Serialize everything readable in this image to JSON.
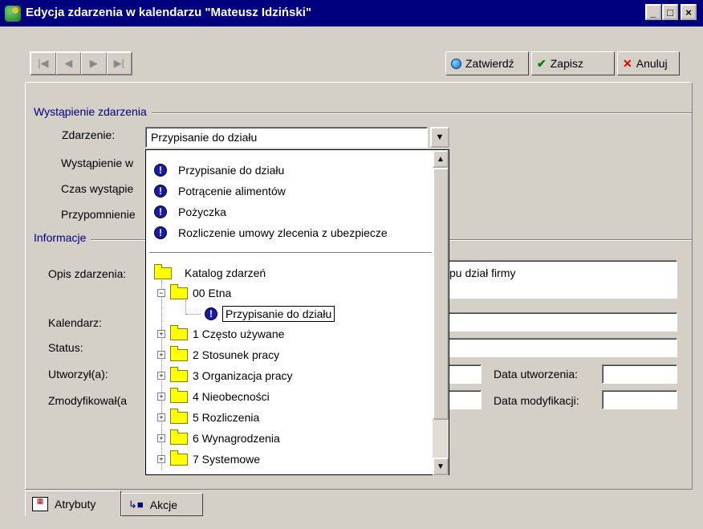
{
  "window": {
    "title": "Edycja zdarzenia w kalendarzu \"Mateusz Idziński\"",
    "controls": [
      "_",
      "□",
      "×"
    ]
  },
  "toolbar": {
    "nav": [
      "|◀",
      "◀",
      "▶",
      "▶|"
    ],
    "confirm_label": "Zatwierdź",
    "save_label": "Zapisz",
    "cancel_label": "Anuluj"
  },
  "occurrence": {
    "section_title": "Wystąpienie zdarzenia",
    "event_label": "Zdarzenie:",
    "event_value": "Przypisanie do działu",
    "occurrence_label": "Wystąpienie w",
    "time_label": "Czas wystąpie",
    "reminder_label": "Przypomnienie"
  },
  "info": {
    "section_title": "Informacje",
    "description_label": "Opis zdarzenia:",
    "description_value": "ypu dział firmy",
    "calendar_label": "Kalendarz:",
    "status_label": "Status:",
    "created_by_label": "Utworzył(a):",
    "modified_by_label": "Zmodyfikował(a",
    "created_date_label": "Data utworzenia:",
    "modified_date_label": "Data modyfikacji:"
  },
  "dropdown": {
    "recent": [
      "Przypisanie do działu",
      "Potrącenie alimentów",
      "Pożyczka",
      "Rozliczenie umowy zlecenia z ubezpiecze"
    ],
    "catalog_root": "Katalog zdarzeń",
    "expanded_folder": "00 Etna",
    "selected_item": "Przypisanie do działu",
    "folders": [
      "1 Często używane",
      "2 Stosunek pracy",
      "3 Organizacja pracy",
      "4 Nieobecności",
      "5 Rozliczenia",
      "6 Wynagrodzenia",
      "7 Systemowe"
    ]
  },
  "tabs": [
    "Atrybuty",
    "Akcje"
  ],
  "colors": {
    "titlebar": "#00007f",
    "section_title": "#00007f",
    "event_icon": "#1a1aa8",
    "folder": "#ffff00"
  }
}
